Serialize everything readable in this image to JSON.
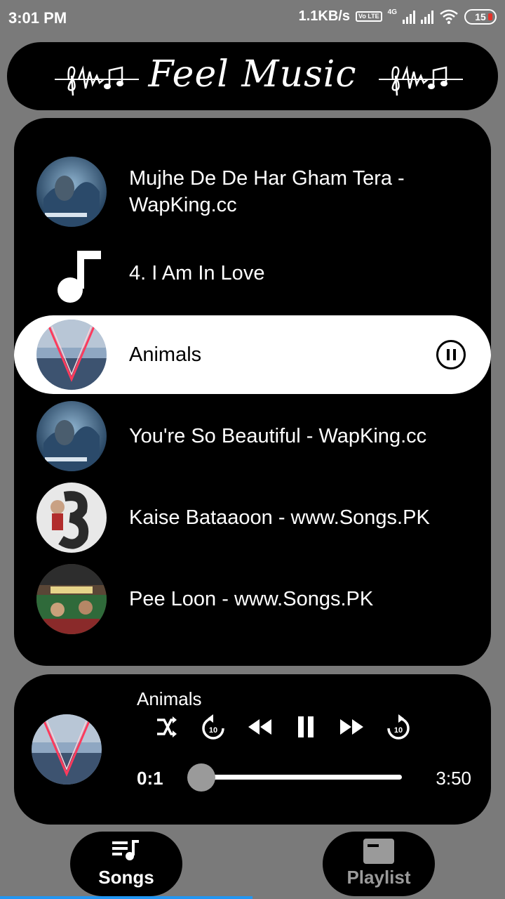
{
  "status_bar": {
    "time": "3:01 PM",
    "net_speed": "1.1KB/s",
    "volte": "Vo LTE",
    "network": "4G",
    "battery": "15"
  },
  "header": {
    "title": "Feel Music"
  },
  "songs": [
    {
      "title": "Mujhe De De Har Gham Tera - WapKing.cc",
      "art": "album-art-blue"
    },
    {
      "title": "4. I Am In Love",
      "art": "music-note-icon"
    },
    {
      "title": "Animals",
      "art": "album-art-maroon5",
      "active": true
    },
    {
      "title": "You're So Beautiful - WapKing.cc",
      "art": "album-art-blue"
    },
    {
      "title": "Kaise Bataaoon - www.Songs.PK",
      "art": "album-art-3"
    },
    {
      "title": "Pee Loon - www.Songs.PK",
      "art": "album-art-mumbai"
    }
  ],
  "player": {
    "title": "Animals",
    "current_time": "0:1",
    "total_time": "3:50",
    "progress": 0.004
  },
  "nav": {
    "songs_label": "Songs",
    "playlist_label": "Playlist"
  },
  "colors": {
    "background": "#7a7a7a",
    "panel": "#000000",
    "active_row": "#ffffff",
    "indicator": "#2196f3"
  }
}
